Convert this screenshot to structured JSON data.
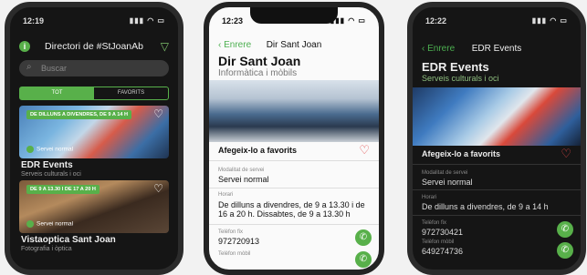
{
  "phone1": {
    "time": "12:19",
    "signal": "▮▮▮ ◠ ▭",
    "title": "Directori de #StJoanAb",
    "search_placeholder": "Buscar",
    "tabs": [
      "TOT",
      "FAVORITS"
    ],
    "cards": [
      {
        "tag": "DE DILLUNS A DIVENDRES, DE 9 A 14 H",
        "chip": "Servei normal",
        "title": "EDR Events",
        "subtitle": "Serveis culturals i oci"
      },
      {
        "tag": "DE 9 A 13.30 I DE 17 A 20 H",
        "chip": "Servei normal",
        "title": "Vistaoptica Sant Joan",
        "subtitle": "Fotografia i òptica"
      }
    ]
  },
  "phone2": {
    "time": "12:23",
    "signal": "▮▮▮ ◠ ▭",
    "back": "Enrere",
    "nav_title": "Dir Sant Joan",
    "title": "Dir Sant Joan",
    "subtitle": "Informàtica i mòbils",
    "favorite": "Afegeix-lo a favorits",
    "modality_label": "Modalitat de servei",
    "modality": "Servei normal",
    "hours_label": "Horari",
    "hours": "De dilluns a divendres, de 9 a 13.30 i de 16 a 20 h. Dissabtes, de 9 a 13.30 h",
    "phone_label": "Telèfon fix",
    "phone": "972720913",
    "mobile_label": "Telèfon mòbil"
  },
  "phone3": {
    "time": "12:22",
    "signal": "▮▮▮ ◠ ▭",
    "back": "Enrere",
    "nav_title": "EDR Events",
    "title": "EDR Events",
    "subtitle": "Serveis culturals i oci",
    "favorite": "Afegeix-lo a favorits",
    "modality_label": "Modalitat de servei",
    "modality": "Servei normal",
    "hours_label": "Horari",
    "hours": "De dilluns a divendres, de 9 a 14 h",
    "phone_label": "Telèfon fix",
    "phone": "972730421",
    "mobile_label": "Telèfon mòbil",
    "mobile": "649274736"
  },
  "colors": {
    "accent": "#58b04a",
    "heart": "#e04848"
  }
}
